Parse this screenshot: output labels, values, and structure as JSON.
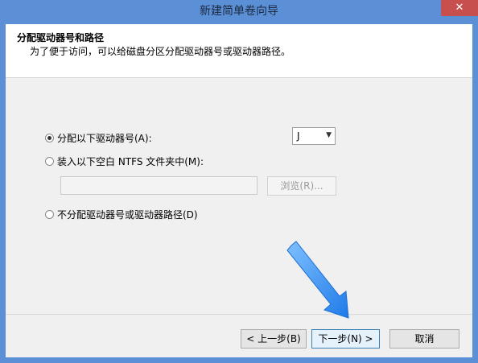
{
  "window": {
    "title": "新建简单卷向导",
    "close_label": "✕"
  },
  "header": {
    "title": "分配驱动器号和路径",
    "description": "为了便于访问，可以给磁盘分区分配驱动器号或驱动器路径。"
  },
  "options": {
    "assign_letter": {
      "label": "分配以下驱动器号(A):",
      "checked": true
    },
    "mount_folder": {
      "label": "装入以下空白 NTFS 文件夹中(M):",
      "checked": false
    },
    "no_assign": {
      "label": "不分配驱动器号或驱动器路径(D)",
      "checked": false
    }
  },
  "drive_letter": {
    "selected": "J",
    "arrow": "▼"
  },
  "folder_path": {
    "value": ""
  },
  "buttons": {
    "browse": "浏览(R)...",
    "back": "< 上一步(B)",
    "next": "下一步(N) >",
    "cancel": "取消"
  },
  "colors": {
    "titlebar": "#5b8fd6",
    "close_button": "#c7504f",
    "dialog_bg": "#f0f0f0",
    "annotation_arrow": "#2e8ff0"
  },
  "annotation": {
    "icon": "blue-arrow-pointing-to-next-button"
  }
}
